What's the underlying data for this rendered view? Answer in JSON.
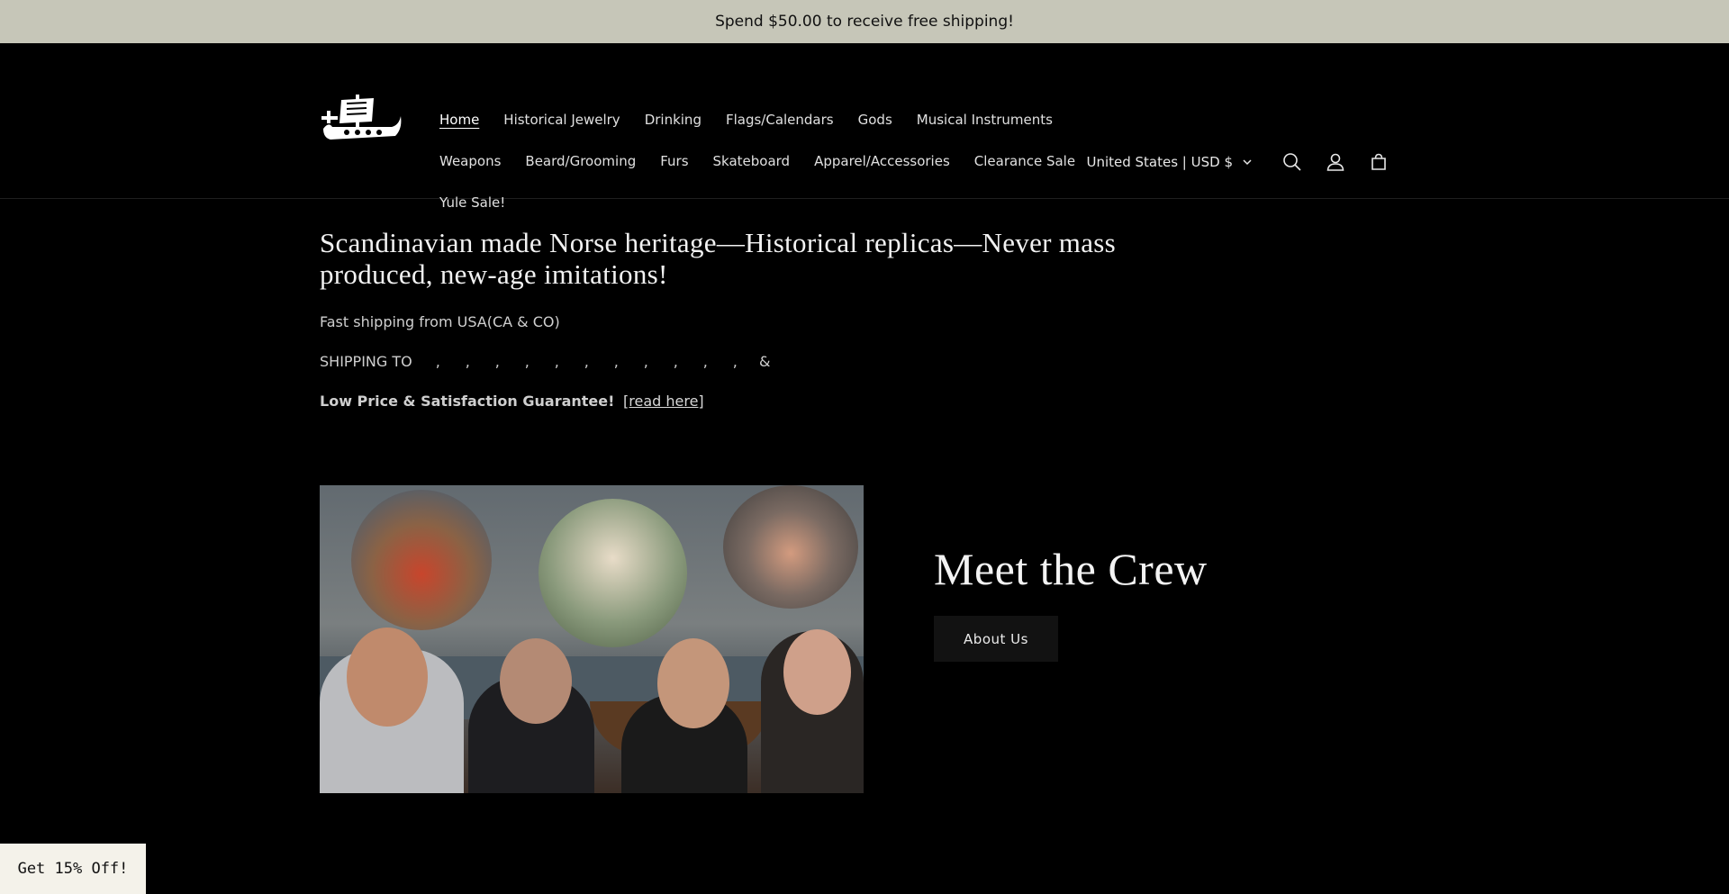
{
  "announcement": {
    "text": "Spend $50.00 to receive free shipping!"
  },
  "header": {
    "nav": {
      "row1": [
        {
          "label": "Home"
        },
        {
          "label": "Historical Jewelry"
        },
        {
          "label": "Drinking"
        },
        {
          "label": "Flags/Calendars"
        },
        {
          "label": "Gods"
        },
        {
          "label": "Musical Instruments"
        }
      ],
      "row2": [
        {
          "label": "Weapons"
        },
        {
          "label": "Beard/Grooming"
        },
        {
          "label": "Furs"
        },
        {
          "label": "Skateboard"
        },
        {
          "label": "Apparel/Accessories"
        },
        {
          "label": "Clearance Sale"
        }
      ],
      "row3": [
        {
          "label": "Yule Sale!"
        }
      ]
    },
    "active_item": "Home",
    "locale": "United States | USD $",
    "icons": [
      "search-icon",
      "account-icon",
      "cart-icon"
    ]
  },
  "hero": {
    "heading": "Scandinavian made Norse heritage—Historical replicas—Never mass produced, new-age imitations!",
    "line1": "Fast shipping from USA(CA & CO)",
    "shipping_to": "SHIPPING TO",
    "flag_separators": [
      ",",
      ",",
      ",",
      ",",
      ",",
      ",",
      ",",
      ",",
      ",",
      ",",
      ",",
      "&"
    ],
    "guarantee": "Low Price & Satisfaction Guarantee!",
    "read_link": "[read here]"
  },
  "crew": {
    "title": "Meet the Crew",
    "button": "About Us"
  },
  "promo": {
    "label": "Get 15% Off!"
  },
  "colors": {
    "announcement_bg": "#c6c6b8",
    "page_bg": "#000000",
    "button_bg": "#121212",
    "promo_bg": "#f4f2ea"
  }
}
